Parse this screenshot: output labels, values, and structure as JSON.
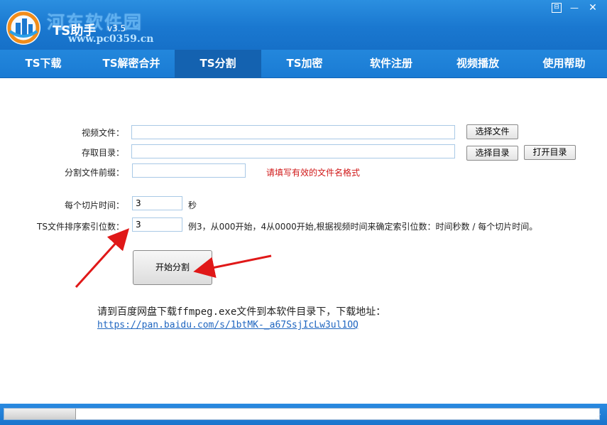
{
  "window": {
    "watermark": "河东软件园",
    "watermark_url": "www.pc0359.cn",
    "title": "TS助手",
    "version": "v3.5",
    "menu_glyph": "⊟",
    "min_glyph": "—",
    "close_glyph": "✕"
  },
  "tabs": [
    {
      "label": "TS下载"
    },
    {
      "label": "TS解密合并"
    },
    {
      "label": "TS分割"
    },
    {
      "label": "TS加密"
    },
    {
      "label": "软件注册"
    },
    {
      "label": "视频播放"
    },
    {
      "label": "使用帮助"
    }
  ],
  "active_tab": "TS分割",
  "form": {
    "video_file_label": "视频文件：",
    "video_file_value": "",
    "select_file_button": "选择文件",
    "save_dir_label": "存取目录：",
    "save_dir_value": "",
    "select_dir_button": "选择目录",
    "open_dir_button": "打开目录",
    "prefix_label": "分割文件前缀：",
    "prefix_value": "",
    "prefix_hint": "请填写有效的文件名格式",
    "slice_time_label": "每个切片时间：",
    "slice_time_value": "3",
    "slice_time_unit": "秒",
    "index_digits_label": "TS文件排序索引位数：",
    "index_digits_value": "3",
    "index_digits_note": "例3，从000开始，4从0000开始,根据视频时间来确定索引位数：时间秒数 / 每个切片时间。",
    "start_button": "开始分割"
  },
  "download": {
    "text": "请到百度网盘下载ffmpeg.exe文件到本软件目录下，下载地址：",
    "link": "https://pan.baidu.com/s/1btMK-_a67SsjIcLw3ul1OQ"
  },
  "status": {
    "progress": 0.12,
    "grip_glyph": "⋰"
  },
  "colors": {
    "titlebar": "#1a78d0",
    "active_tab": "#1462b0",
    "hint": "#d01818",
    "link": "#1f66c0",
    "arrow": "#e01818"
  },
  "icons": {
    "logo": "ts-helper-logo",
    "annotation": "red-arrow"
  }
}
